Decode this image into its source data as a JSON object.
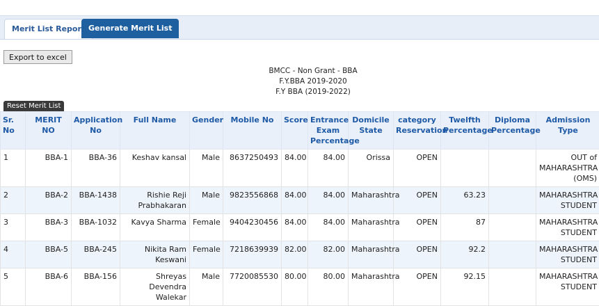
{
  "tabs": {
    "report_label": "Merit List Report",
    "generate_label": "Generate Merit List"
  },
  "toolbar": {
    "export_label": "Export to excel",
    "reset_label": "Reset Merit List"
  },
  "heading": {
    "line1": "BMCC - Non Grant - BBA",
    "line2": "F.Y.BBA 2019-2020",
    "line3": "F.Y BBA (2019-2022)"
  },
  "table": {
    "columns": [
      "Sr. No",
      "MERIT NO",
      "Application No",
      "Full Name",
      "Gender",
      "Mobile No",
      "Score",
      "Entrance Exam Percentage",
      "Domicile State",
      "category Reservation",
      "Twelfth Percentage",
      "Diploma Percentage",
      "Admission Type"
    ],
    "rows": [
      [
        "1",
        "BBA-1",
        "BBA-36",
        "Keshav kansal",
        "Male",
        "8637250493",
        "84.00",
        "84.00",
        "Orissa",
        "OPEN",
        "",
        "",
        "OUT of MAHARASHTRA (OMS)"
      ],
      [
        "2",
        "BBA-2",
        "BBA-1438",
        "Rishie Reji Prabhakaran",
        "Male",
        "9823556868",
        "84.00",
        "84.00",
        "Maharashtra",
        "OPEN",
        "63.23",
        "",
        "MAHARASHTRA STUDENT"
      ],
      [
        "3",
        "BBA-3",
        "BBA-1032",
        "Kavya Sharma",
        "Female",
        "9404230456",
        "84.00",
        "84.00",
        "Maharashtra",
        "OPEN",
        "87",
        "",
        "MAHARASHTRA STUDENT"
      ],
      [
        "4",
        "BBA-5",
        "BBA-245",
        "Nikita Ram Keswani",
        "Female",
        "7218639939",
        "82.00",
        "82.00",
        "Maharashtra",
        "OPEN",
        "92.2",
        "",
        "MAHARASHTRA STUDENT"
      ],
      [
        "5",
        "BBA-6",
        "BBA-156",
        "Shreyas Devendra Walekar",
        "Male",
        "7720085530",
        "80.00",
        "80.00",
        "Maharashtra",
        "OPEN",
        "92.15",
        "",
        "MAHARASHTRA STUDENT"
      ]
    ]
  },
  "colors": {
    "header_text": "#1f5aa6",
    "active_tab": "#1e5fa0",
    "row_alt": "#eef4fb"
  }
}
